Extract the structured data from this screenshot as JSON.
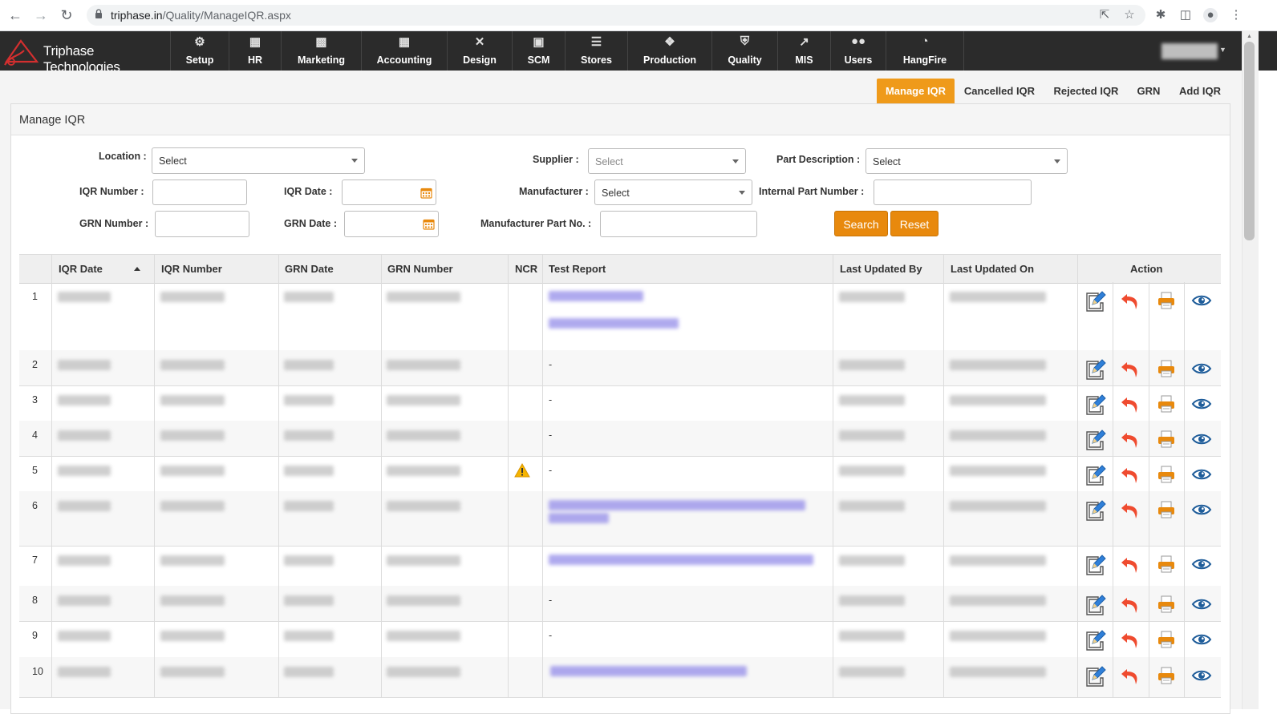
{
  "browser": {
    "url_host": "triphase.in",
    "url_path": "/Quality/ManageIQR.aspx"
  },
  "app": {
    "brand": "Triphase Technologies",
    "menu": [
      {
        "label": "Setup",
        "icon": "gear-icon"
      },
      {
        "label": "HR",
        "icon": "sitemap-icon"
      },
      {
        "label": "Marketing",
        "icon": "briefcase-icon"
      },
      {
        "label": "Accounting",
        "icon": "calculator-icon"
      },
      {
        "label": "Design",
        "icon": "wrench-icon"
      },
      {
        "label": "SCM",
        "icon": "cart-icon"
      },
      {
        "label": "Stores",
        "icon": "database-icon"
      },
      {
        "label": "Production",
        "icon": "cubes-icon"
      },
      {
        "label": "Quality",
        "icon": "shield-icon"
      },
      {
        "label": "MIS",
        "icon": "line-chart-icon"
      },
      {
        "label": "Users",
        "icon": "users-icon"
      },
      {
        "label": "HangFire",
        "icon": "dashboard-icon"
      }
    ]
  },
  "tabs": [
    "Manage IQR",
    "Cancelled IQR",
    "Rejected IQR",
    "GRN",
    "Add IQR"
  ],
  "panel": {
    "title": "Manage IQR"
  },
  "filters": {
    "location_label": "Location :",
    "location_value": "Select",
    "supplier_label": "Supplier :",
    "supplier_placeholder": "Select",
    "part_description_label": "Part Description :",
    "part_description_value": "Select",
    "iqr_number_label": "IQR Number :",
    "iqr_date_label": "IQR Date :",
    "manufacturer_label": "Manufacturer :",
    "manufacturer_value": "Select",
    "internal_part_number_label": "Internal Part Number :",
    "grn_number_label": "GRN Number :",
    "grn_date_label": "GRN Date :",
    "manufacturer_part_no_label": "Manufacturer Part No. :",
    "search_label": "Search",
    "reset_label": "Reset"
  },
  "table": {
    "headers": [
      "IQR Date",
      "IQR Number",
      "GRN Date",
      "GRN Number",
      "NCR",
      "Test Report",
      "Last Updated By",
      "Last Updated On",
      "Action"
    ],
    "rows": [
      {
        "n": "1",
        "test_report": ""
      },
      {
        "n": "2",
        "test_report": "-"
      },
      {
        "n": "3",
        "test_report": "-"
      },
      {
        "n": "4",
        "test_report": "-"
      },
      {
        "n": "5",
        "test_report": "-",
        "ncr_warning": true
      },
      {
        "n": "6",
        "test_report": ""
      },
      {
        "n": "7",
        "test_report": ""
      },
      {
        "n": "8",
        "test_report": "-"
      },
      {
        "n": "9",
        "test_report": "-"
      },
      {
        "n": "10",
        "test_report": ""
      }
    ]
  },
  "colors": {
    "nav_bg": "#2b2b2b",
    "accent": "#ef9a1a",
    "button": "#e8890d"
  }
}
